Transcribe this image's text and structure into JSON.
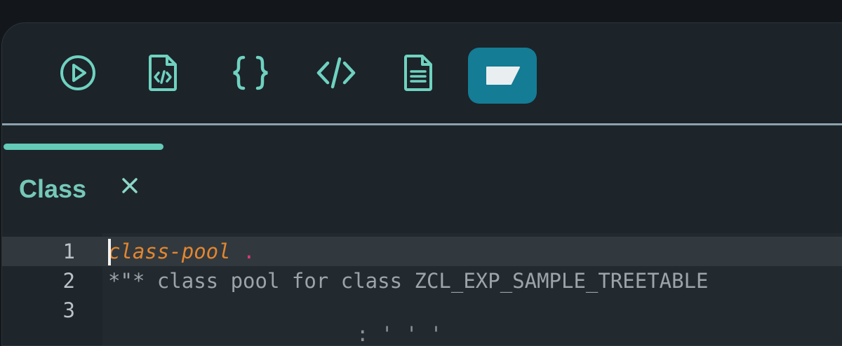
{
  "toolbar": {
    "buttons": [
      {
        "id": "run",
        "icon": "play-circle-icon"
      },
      {
        "id": "file-code",
        "icon": "file-code-icon"
      },
      {
        "id": "braces",
        "icon": "curly-braces-icon"
      },
      {
        "id": "code",
        "icon": "code-tag-icon"
      },
      {
        "id": "document",
        "icon": "document-text-icon"
      },
      {
        "id": "editor-mode",
        "icon": "label-shape-icon",
        "active": true
      }
    ],
    "accent_color": "#147c95"
  },
  "tabs": [
    {
      "label": "Class",
      "close_glyph": "✕",
      "active": true
    }
  ],
  "editor": {
    "lines": [
      {
        "number": "1",
        "keyword": "class-pool",
        "punct": ".",
        "current": true
      },
      {
        "number": "2",
        "text": "*\"* class pool for class ZCL_EXP_SAMPLE_TREETABLE"
      },
      {
        "number": "3",
        "text": ""
      }
    ],
    "partial_text": ": ' ' '"
  }
}
